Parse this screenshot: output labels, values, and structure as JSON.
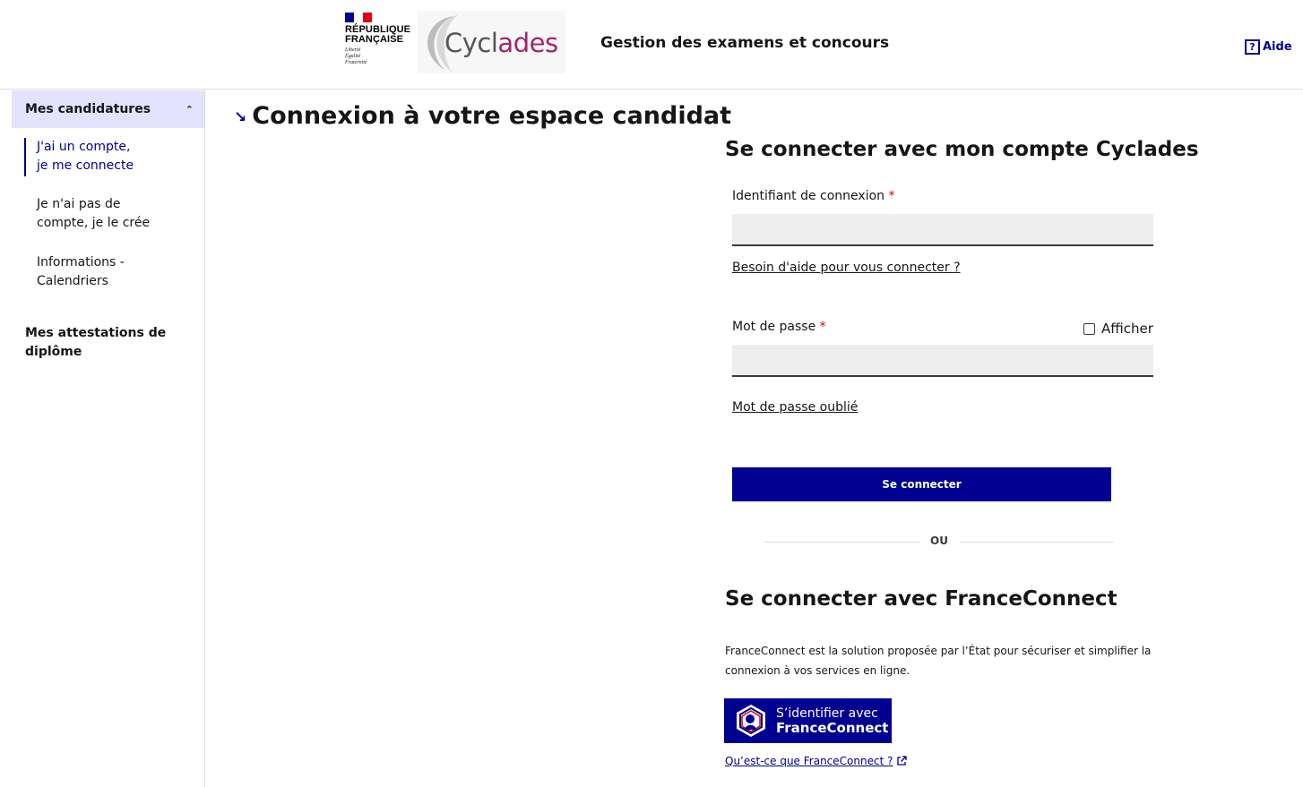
{
  "header": {
    "republic_line1": "RÉPUBLIQUE",
    "republic_line2": "FRANÇAISE",
    "motto1": "Liberté",
    "motto2": "Égalité",
    "motto3": "Fraternité",
    "logo_part1": "Cycl",
    "logo_part2": "ades",
    "service_title": "Gestion des examens et concours",
    "help_label": "Aide",
    "help_icon": "?",
    "flag_colors": [
      "#000091",
      "#ffffff",
      "#e1000f"
    ]
  },
  "sidebar": {
    "section1": "Mes candidatures",
    "section1_chevron": "⌃",
    "items": [
      {
        "line1": "J'ai un compte,",
        "line2": "je me connecte",
        "active": true
      },
      {
        "line1": "Je n'ai pas de",
        "line2": "compte, je le crée",
        "active": false
      },
      {
        "line1": "Informations -",
        "line2": "Calendriers",
        "active": false
      }
    ],
    "section2_line1": "Mes attestations de",
    "section2_line2": "diplôme"
  },
  "main": {
    "title_arrow": "↘",
    "title": "Connexion à votre espace candidat",
    "cyclades_heading": "Se connecter avec mon compte Cyclades",
    "login_label": "Identifiant de connexion",
    "required_mark": "*",
    "login_value": "",
    "help_link": "Besoin d'aide pour vous connecter ?",
    "password_label": "Mot de passe",
    "show_password": "Afficher",
    "password_value": "",
    "forgot_link": "Mot de passe oublié",
    "submit": "Se connecter",
    "separator": "OU",
    "fc_heading": "Se connecter avec FranceConnect",
    "fc_desc_line1": "FranceConnect est la solution proposée par l’État pour sécuriser et simplifier la",
    "fc_desc_line2": "connexion à vos services en ligne.",
    "fc_btn_line1": "S’identifier avec",
    "fc_btn_line2": "FranceConnect",
    "fc_info_link": "Qu’est-ce que FranceConnect ?",
    "accent_color": "#000091"
  }
}
